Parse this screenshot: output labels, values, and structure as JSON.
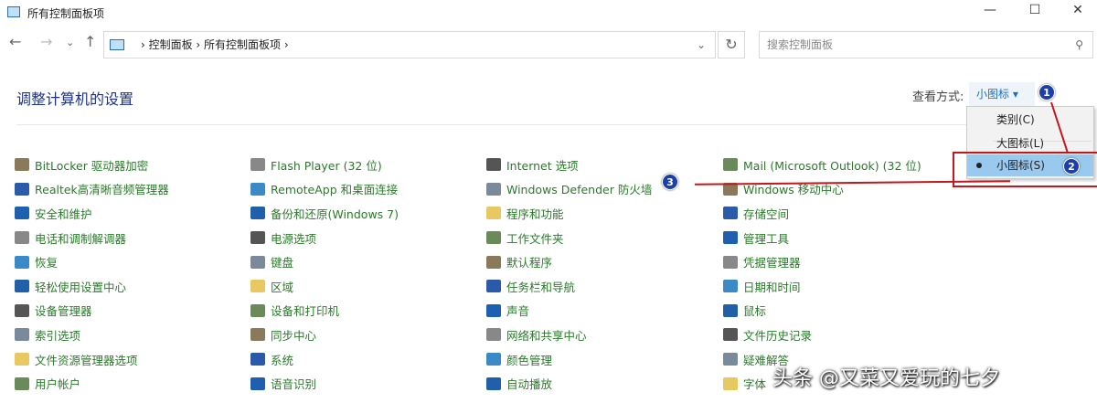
{
  "window": {
    "title": "所有控制面板项",
    "minimize": "—",
    "maximize": "☐",
    "close": "✕"
  },
  "nav": {
    "back": "←",
    "forward": "→",
    "dropdown": "⌄",
    "up": "↑"
  },
  "address": {
    "path": "› 控制面板 › 所有控制面板项 ›",
    "dropdown": "⌄",
    "refresh": "↻"
  },
  "search": {
    "placeholder": "搜索控制面板",
    "icon": "⚲"
  },
  "heading": "调整计算机的设置",
  "view": {
    "label": "查看方式:",
    "selected": "小图标 ▾",
    "options": [
      "类别(C)",
      "大图标(L)",
      "小图标(S)"
    ]
  },
  "badges": [
    "1",
    "2",
    "3"
  ],
  "columns": [
    [
      "BitLocker 驱动器加密",
      "Realtek高清晰音频管理器",
      "安全和维护",
      "电话和调制解调器",
      "恢复",
      "轻松使用设置中心",
      "设备管理器",
      "索引选项",
      "文件资源管理器选项",
      "用户帐户"
    ],
    [
      "Flash Player (32 位)",
      "RemoteApp 和桌面连接",
      "备份和还原(Windows 7)",
      "电源选项",
      "键盘",
      "区域",
      "设备和打印机",
      "同步中心",
      "系统",
      "语音识别"
    ],
    [
      "Internet 选项",
      "Windows Defender 防火墙",
      "程序和功能",
      "工作文件夹",
      "默认程序",
      "任务栏和导航",
      "声音",
      "网络和共享中心",
      "颜色管理",
      "自动播放"
    ],
    [
      "Mail (Microsoft Outlook) (32 位)",
      "Windows 移动中心",
      "存储空间",
      "管理工具",
      "凭据管理器",
      "日期和时间",
      "鼠标",
      "文件历史记录",
      "疑难解答",
      "字体"
    ]
  ],
  "icon_colors": [
    "#8a7a5a",
    "#2a5aa8",
    "#1e5fb0",
    "#888888",
    "#3a8ac8",
    "#2060a8",
    "#555555",
    "#7a8a9a",
    "#e8c860",
    "#6a8a5a"
  ],
  "watermark": "头条 @又菜又爱玩的七夕"
}
